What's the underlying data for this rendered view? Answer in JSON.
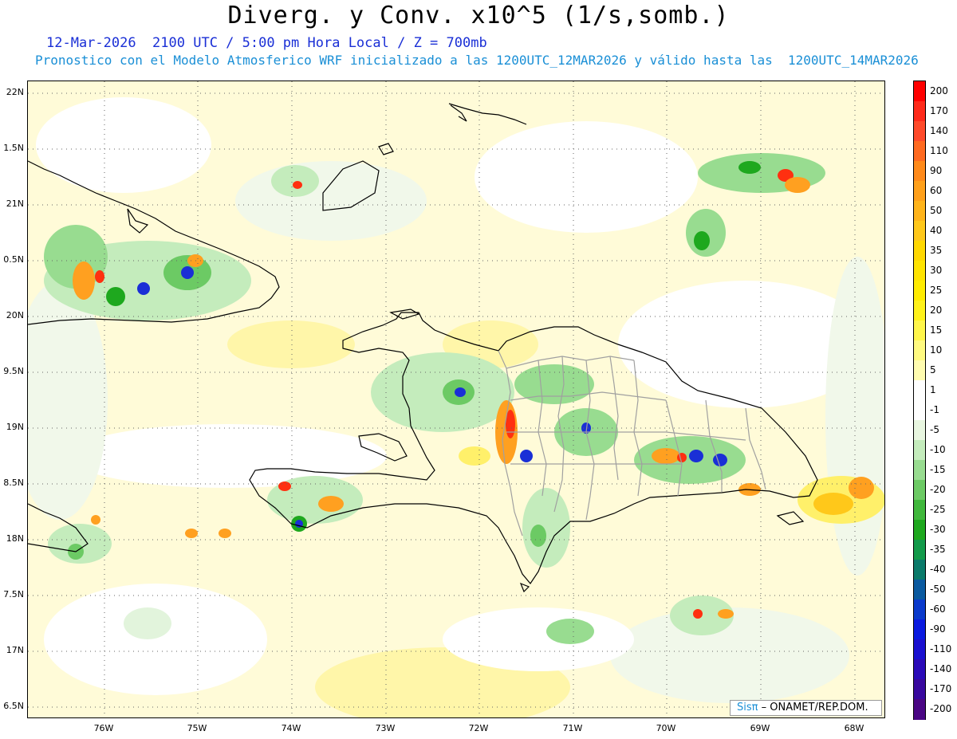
{
  "header": {
    "title": "Diverg. y Conv. x10^5 (1/s,somb.)",
    "line1": "12-Mar-2026  2100 UTC / 5:00 pm Hora Local / Z = 700mb",
    "line2": "Pronostico con el Modelo Atmosferico WRF inicializado a las 1200UTC_12MAR2026 y válido hasta las  1200UTC_14MAR2026"
  },
  "axes": {
    "lat_labels": [
      "22N",
      "1.5N",
      "21N",
      "0.5N",
      "20N",
      "9.5N",
      "19N",
      "8.5N",
      "18N",
      "7.5N",
      "17N",
      "6.5N"
    ],
    "lon_labels": [
      "76W",
      "75W",
      "74W",
      "73W",
      "72W",
      "71W",
      "70W",
      "69W",
      "68W"
    ]
  },
  "colorbar": {
    "labels": [
      "200",
      "170",
      "140",
      "110",
      "90",
      "60",
      "50",
      "40",
      "35",
      "30",
      "25",
      "20",
      "15",
      "10",
      "5",
      "1",
      "-1",
      "-5",
      "-10",
      "-15",
      "-20",
      "-25",
      "-30",
      "-35",
      "-40",
      "-50",
      "-60",
      "-90",
      "-110",
      "-140",
      "-170",
      "-200"
    ],
    "colors": [
      "#ff0000",
      "#ff2a1a",
      "#ff4a2a",
      "#ff6a20",
      "#ff8a1a",
      "#ffa01a",
      "#ffb41a",
      "#ffc81a",
      "#ffd800",
      "#ffe400",
      "#ffec00",
      "#fff21a",
      "#fff64a",
      "#fffa80",
      "#fffcb0",
      "#ffffff",
      "#ffffff",
      "#e8f6e0",
      "#c4ecbc",
      "#98dc90",
      "#6cca64",
      "#40b83c",
      "#1ea81e",
      "#129a4a",
      "#0a7a6a",
      "#0a5aa0",
      "#0a3acc",
      "#0a1ae0",
      "#1a10d0",
      "#2a0ab8",
      "#38089e",
      "#4a0684"
    ]
  },
  "map": {
    "colors": {
      "yellow": "#fff6a0",
      "pale_yellow": "#fffbd0",
      "pale_green": "#e2f4dc",
      "green": "#9ad88e",
      "dark_green": "#1ea81e",
      "orange": "#ffa020",
      "red": "#ff3010",
      "blue": "#1a2fd6",
      "coast": "#000000",
      "border": "#a0a0a0"
    }
  },
  "credit": {
    "logo": "Sisπ",
    "org": "– ONAMET/REP.DOM."
  }
}
